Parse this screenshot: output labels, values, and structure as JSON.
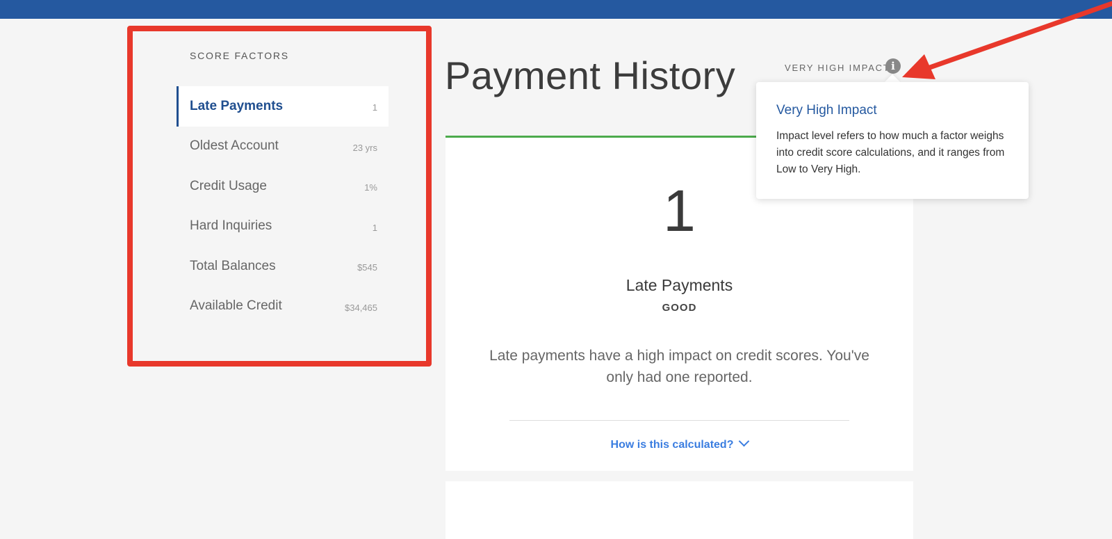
{
  "sidebar": {
    "title": "SCORE FACTORS",
    "items": [
      {
        "label": "Late Payments",
        "value": "1",
        "active": true
      },
      {
        "label": "Oldest Account",
        "value": "23 yrs",
        "active": false
      },
      {
        "label": "Credit Usage",
        "value": "1%",
        "active": false
      },
      {
        "label": "Hard Inquiries",
        "value": "1",
        "active": false
      },
      {
        "label": "Total Balances",
        "value": "$545",
        "active": false
      },
      {
        "label": "Available Credit",
        "value": "$34,465",
        "active": false
      }
    ]
  },
  "main": {
    "title": "Payment History",
    "impact_label": "VERY HIGH IMPACT",
    "card": {
      "number": "1",
      "heading": "Late Payments",
      "rating": "GOOD",
      "description": "Late payments have a high impact on credit scores. You've only had one reported.",
      "calc_link": "How is this calculated?"
    }
  },
  "tooltip": {
    "title": "Very High Impact",
    "body": "Impact level refers to how much a factor weighs into credit score calculations, and it ranges from Low to Very High."
  },
  "colors": {
    "topbar": "#2559a0",
    "accent_blue": "#1f4e8f",
    "link_blue": "#3a7de0",
    "good_green": "#4caa4c",
    "annotation_red": "#e8382b"
  },
  "icons": {
    "info": "info-icon",
    "chevron": "chevron-down-icon"
  }
}
